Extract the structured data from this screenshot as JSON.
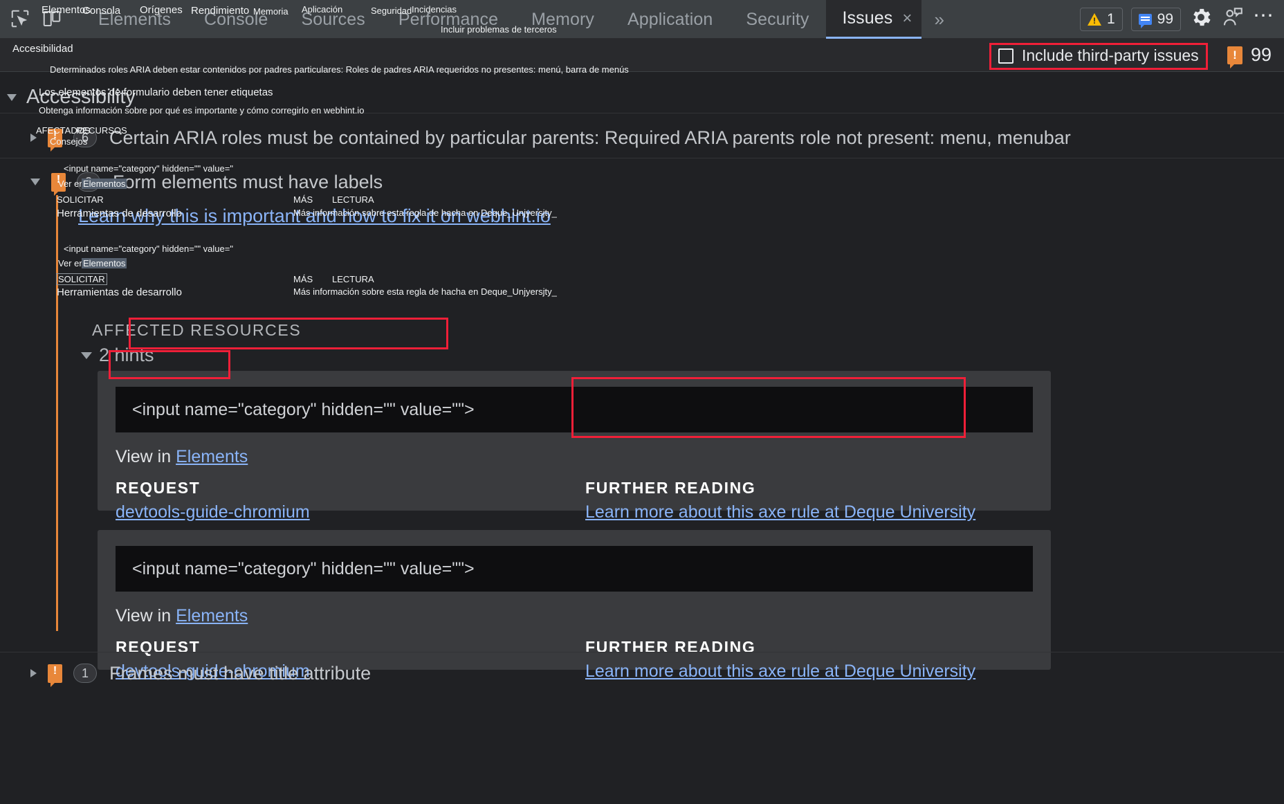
{
  "toolbar": {
    "icons": [
      {
        "name": "inspect-element-icon"
      },
      {
        "name": "device-toolbar-icon"
      }
    ],
    "tabs": [
      {
        "label": "Elements",
        "active": false
      },
      {
        "label": "Console",
        "active": false
      },
      {
        "label": "Sources",
        "active": false
      },
      {
        "label": "Performance",
        "active": false
      },
      {
        "label": "Memory",
        "active": false
      },
      {
        "label": "Application",
        "active": false
      },
      {
        "label": "Security",
        "active": false
      },
      {
        "label": "Issues",
        "active": true
      }
    ],
    "tab_close_glyph": "×",
    "more_tabs_glyph": "»",
    "warning_count": "1",
    "issues_count": "99",
    "settings_icon": "gear-icon",
    "feedback_icon": "person-feedback-icon",
    "more_options_glyph": "⋯"
  },
  "filterbar": {
    "third_party_label": "Include third-party issues",
    "third_party_checked": false,
    "issue_count": "99"
  },
  "tree": {
    "group_title": "Accessibility",
    "issues": [
      {
        "title": "Certain ARIA roles must be contained by particular parents: Required ARIA parents role not present: menu, menubar",
        "count": "6",
        "expanded": false
      },
      {
        "title": "Form elements must have labels",
        "count": "2",
        "expanded": true
      },
      {
        "title": "Frames must have title attribute",
        "count": "1",
        "expanded": false
      }
    ]
  },
  "detail": {
    "webhint_link": "Learn why this is important and how to fix it on webhint.io",
    "affected_resources_label": "AFFECTED RESOURCES",
    "hints_label": "2 hints",
    "cards": [
      {
        "code": "<input name=\"category\" hidden=\"\" value=\"\">",
        "view_in_prefix": "View in",
        "view_in_link": "Elements",
        "request_label": "REQUEST",
        "request_link": "devtools-guide-chromium",
        "further_reading_label": "FURTHER READING",
        "further_reading_link": "Learn more about this axe rule at Deque University"
      },
      {
        "code": "<input name=\"category\" hidden=\"\" value=\"\">",
        "view_in_prefix": "View in",
        "view_in_link": "Elements",
        "request_label": "REQUEST",
        "request_link": "devtools-guide-chromium",
        "further_reading_label": "FURTHER READING",
        "further_reading_link": "Learn more about this axe rule at Deque University"
      }
    ]
  },
  "annotations": {
    "tab_elements": "Elementos",
    "tab_console": "Consola",
    "tab_sources": "Orígenes",
    "tab_performance": "Rendimiento",
    "tab_memory": "Memoria",
    "tab_application": "Aplicación",
    "tab_security": "Seguridad",
    "tab_issues": "Incidencias",
    "third_party": "Incluir problemas de terceros",
    "accessibility": "Accesibilidad",
    "aria_issue": "Determinados roles ARIA deben estar contenidos por padres particulares: Roles de padres ARIA requeridos no presentes: menú, barra de menús",
    "form_labels": "Los elementos de formulario deben tener etiquetas",
    "webhint": "Obtenga información sobre por qué es importante y cómo corregirlo en webhint.io",
    "affected": "AFECTADOS",
    "resources": "RECURSOS",
    "hints": "Consejos",
    "code_snippet": "<input name=\"category\" hidden=\"\" value=\"",
    "view_in": "Ver en",
    "elements": "Elementos",
    "request": "SOLICITAR",
    "devtools": "Herramientas de desarrollo",
    "more": "MÁS",
    "reading": "LECTURA",
    "deque": "Más información sobre esta regla de hacha en Deque_Unjyersjty_"
  },
  "colors": {
    "accent_blue": "#8ab4f8",
    "annotation_red": "#f01f38",
    "issue_orange": "#e8873a",
    "warning_yellow": "#fbbc04"
  }
}
